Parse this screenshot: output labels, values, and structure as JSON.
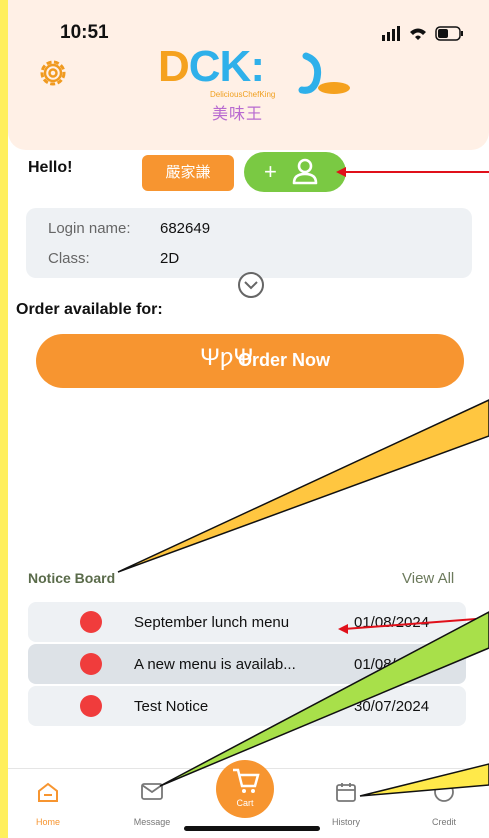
{
  "status_bar": {
    "time": "10:51"
  },
  "logo": {
    "text_d": "D",
    "text_rest": "CK:",
    "subtitle": "DeliciousChefKing",
    "chinese": "美味王"
  },
  "greeting": {
    "hello": "Hello!",
    "student_name": "嚴家謙"
  },
  "info": {
    "login_label": "Login name:",
    "login_value": "682649",
    "class_label": "Class:",
    "class_value": "2D"
  },
  "order": {
    "available_for": "Order available for:",
    "button_label": "Order Now"
  },
  "notice_board": {
    "title": "Notice Board",
    "view_all": "View All",
    "items": [
      {
        "title": "September lunch menu",
        "date": "01/08/2024"
      },
      {
        "title": "A new menu is availab...",
        "date": "01/08/2024"
      },
      {
        "title": "Test Notice",
        "date": "30/07/2024"
      }
    ]
  },
  "tabbar": {
    "home": "Home",
    "message": "Message",
    "cart": "Cart",
    "history": "History",
    "credit": "Credit"
  },
  "colors": {
    "accent_orange": "#f79530",
    "accent_green": "#7ac943",
    "header_bg": "#fff0e6",
    "page_border": "#fffbc9",
    "annotation_red": "#e0101a",
    "annotation_yellow": "#ffc640",
    "annotation_green": "#a8e04a"
  }
}
